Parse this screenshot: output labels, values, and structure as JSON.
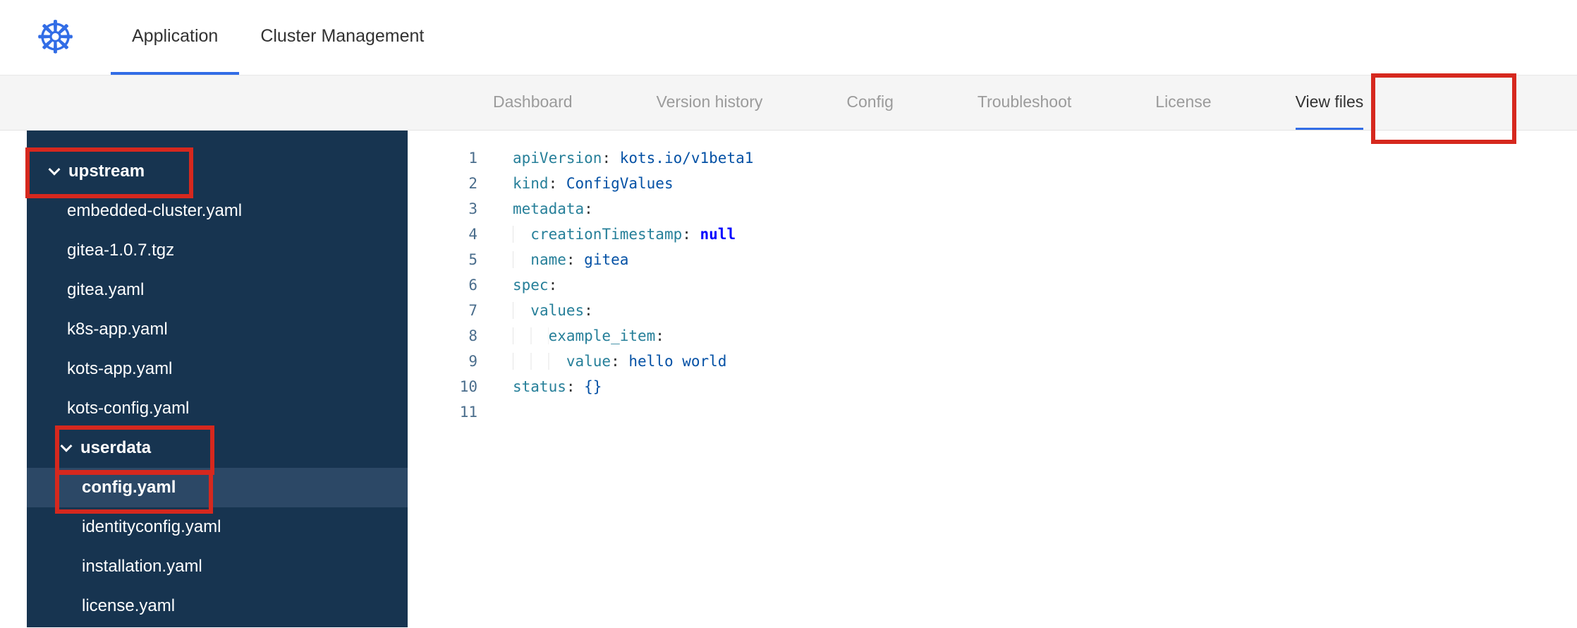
{
  "logo": {
    "glyph": "☸",
    "name": "kubernetes"
  },
  "header": {
    "tabs": [
      {
        "label": "Application",
        "active": true
      },
      {
        "label": "Cluster Management",
        "active": false
      }
    ]
  },
  "subnav": {
    "items": [
      {
        "label": "Dashboard",
        "active": false
      },
      {
        "label": "Version history",
        "active": false
      },
      {
        "label": "Config",
        "active": false
      },
      {
        "label": "Troubleshoot",
        "active": false
      },
      {
        "label": "License",
        "active": false
      },
      {
        "label": "View files",
        "active": true,
        "annotated": true
      }
    ]
  },
  "file_tree": {
    "items": [
      {
        "label": "upstream",
        "type": "folder",
        "depth": 0,
        "expanded": true,
        "selected": false,
        "annotated": true
      },
      {
        "label": "embedded-cluster.yaml",
        "type": "file",
        "depth": 1,
        "selected": false
      },
      {
        "label": "gitea-1.0.7.tgz",
        "type": "file",
        "depth": 1,
        "selected": false
      },
      {
        "label": "gitea.yaml",
        "type": "file",
        "depth": 1,
        "selected": false
      },
      {
        "label": "k8s-app.yaml",
        "type": "file",
        "depth": 1,
        "selected": false
      },
      {
        "label": "kots-app.yaml",
        "type": "file",
        "depth": 1,
        "selected": false
      },
      {
        "label": "kots-config.yaml",
        "type": "file",
        "depth": 1,
        "selected": false
      },
      {
        "label": "userdata",
        "type": "folder",
        "depth": 1,
        "expanded": true,
        "selected": false,
        "annotated": true
      },
      {
        "label": "config.yaml",
        "type": "file",
        "depth": 2,
        "selected": true,
        "annotated": true
      },
      {
        "label": "identityconfig.yaml",
        "type": "file",
        "depth": 2,
        "selected": false
      },
      {
        "label": "installation.yaml",
        "type": "file",
        "depth": 2,
        "selected": false
      },
      {
        "label": "license.yaml",
        "type": "file",
        "depth": 2,
        "selected": false
      }
    ]
  },
  "editor": {
    "lines": [
      {
        "num": 1,
        "tokens": [
          [
            "key",
            "apiVersion"
          ],
          [
            "punc",
            ": "
          ],
          [
            "str",
            "kots.io/v1beta1"
          ]
        ]
      },
      {
        "num": 2,
        "tokens": [
          [
            "key",
            "kind"
          ],
          [
            "punc",
            ": "
          ],
          [
            "str",
            "ConfigValues"
          ]
        ]
      },
      {
        "num": 3,
        "tokens": [
          [
            "key",
            "metadata"
          ],
          [
            "punc",
            ":"
          ]
        ]
      },
      {
        "num": 4,
        "tokens": [
          [
            "ind",
            "  "
          ],
          [
            "key",
            "creationTimestamp"
          ],
          [
            "punc",
            ": "
          ],
          [
            "kw",
            "null"
          ]
        ]
      },
      {
        "num": 5,
        "tokens": [
          [
            "ind",
            "  "
          ],
          [
            "key",
            "name"
          ],
          [
            "punc",
            ": "
          ],
          [
            "str",
            "gitea"
          ]
        ]
      },
      {
        "num": 6,
        "tokens": [
          [
            "key",
            "spec"
          ],
          [
            "punc",
            ":"
          ]
        ]
      },
      {
        "num": 7,
        "tokens": [
          [
            "ind",
            "  "
          ],
          [
            "key",
            "values"
          ],
          [
            "punc",
            ":"
          ]
        ]
      },
      {
        "num": 8,
        "tokens": [
          [
            "ind",
            "    "
          ],
          [
            "key",
            "example_item"
          ],
          [
            "punc",
            ":"
          ]
        ]
      },
      {
        "num": 9,
        "tokens": [
          [
            "ind",
            "      "
          ],
          [
            "key",
            "value"
          ],
          [
            "punc",
            ": "
          ],
          [
            "str",
            "hello world"
          ]
        ]
      },
      {
        "num": 10,
        "tokens": [
          [
            "key",
            "status"
          ],
          [
            "punc",
            ": "
          ],
          [
            "str",
            "{}"
          ]
        ]
      },
      {
        "num": 11,
        "tokens": []
      }
    ]
  },
  "annotations": {
    "boxes": [
      {
        "name": "view-files"
      },
      {
        "name": "upstream"
      },
      {
        "name": "userdata"
      },
      {
        "name": "config"
      }
    ]
  },
  "colors": {
    "accent": "#326de6",
    "annotation": "#d6281e",
    "sidebar-bg": "#173450",
    "sidebar-selected": "#2c4866",
    "syntax-key": "#267f99",
    "syntax-str": "#0451a5",
    "syntax-kw": "#0000ff",
    "syntax-punc": "#333333",
    "linenum": "#4a6d8c"
  }
}
